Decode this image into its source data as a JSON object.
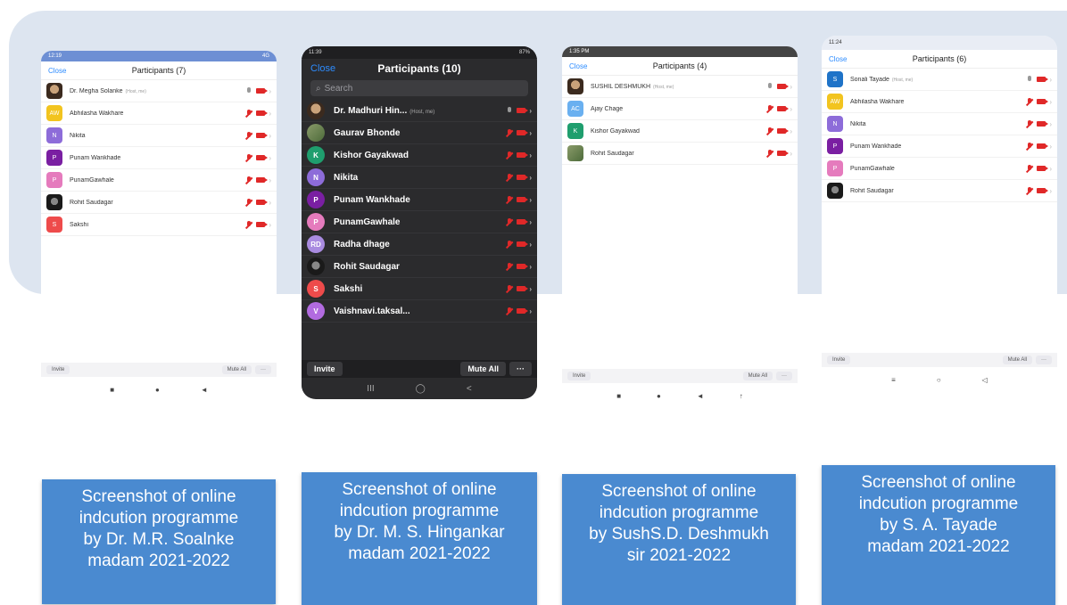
{
  "phones": [
    {
      "status_time": "12:19",
      "status_right": "4G",
      "close": "Close",
      "title": "Participants (7)",
      "participants": [
        {
          "name": "Dr. Megha Solanke",
          "tag": "(Host, me)",
          "avatar": "",
          "color": "#c9a27a"
        },
        {
          "name": "Abhilasha Wakhare",
          "tag": "",
          "avatar": "AW",
          "color": "#f2c41f"
        },
        {
          "name": "Nikita",
          "tag": "",
          "avatar": "N",
          "color": "#8d6cd9"
        },
        {
          "name": "Punam Wankhade",
          "tag": "",
          "avatar": "P",
          "color": "#7a1fa2"
        },
        {
          "name": "PunamGawhale",
          "tag": "",
          "avatar": "P",
          "color": "#e57bbd"
        },
        {
          "name": "Rohit Saudagar",
          "tag": "",
          "avatar": "",
          "color": "#222222"
        },
        {
          "name": "Sakshi",
          "tag": "",
          "avatar": "S",
          "color": "#ee4b4b"
        }
      ],
      "invite": "Invite",
      "mute_all": "Mute All",
      "more": "···",
      "nav": [
        "■",
        "●",
        "◄"
      ]
    },
    {
      "status_time": "11:39",
      "status_right": "87%",
      "close": "Close",
      "title": "Participants (10)",
      "search_placeholder": "Search",
      "participants": [
        {
          "name": "Dr. Madhuri Hin...",
          "tag": "(Host, me)",
          "avatar": "",
          "color": "#c9a27a"
        },
        {
          "name": "Gaurav Bhonde",
          "tag": "",
          "avatar": "",
          "color": "#6b8a4a"
        },
        {
          "name": "Kishor Gayakwad",
          "tag": "",
          "avatar": "K",
          "color": "#1f9e6e"
        },
        {
          "name": "Nikita",
          "tag": "",
          "avatar": "N",
          "color": "#8d6cd9"
        },
        {
          "name": "Punam Wankhade",
          "tag": "",
          "avatar": "P",
          "color": "#7a1fa2"
        },
        {
          "name": "PunamGawhale",
          "tag": "",
          "avatar": "P",
          "color": "#e57bbd"
        },
        {
          "name": "Radha dhage",
          "tag": "",
          "avatar": "RD",
          "color": "#a98be0"
        },
        {
          "name": "Rohit Saudagar",
          "tag": "",
          "avatar": "",
          "color": "#222222"
        },
        {
          "name": "Sakshi",
          "tag": "",
          "avatar": "S",
          "color": "#ee4b4b"
        },
        {
          "name": "Vaishnavi.taksal...",
          "tag": "",
          "avatar": "V",
          "color": "#b26be0"
        }
      ],
      "invite": "Invite",
      "mute_all": "Mute All",
      "more": "···",
      "nav": [
        "III",
        "◯",
        "<"
      ]
    },
    {
      "status_time": "1:35 PM",
      "status_right": "",
      "close": "Close",
      "title": "Participants (4)",
      "participants": [
        {
          "name": "SUSHIL DESHMUKH",
          "tag": "(Host, me)",
          "avatar": "",
          "color": "#8a4a2a"
        },
        {
          "name": "Ajay Chage",
          "tag": "",
          "avatar": "AC",
          "color": "#6ab0f0"
        },
        {
          "name": "Kishor Gayakwad",
          "tag": "",
          "avatar": "K",
          "color": "#1f9e6e"
        },
        {
          "name": "Rohit Saudagar",
          "tag": "",
          "avatar": "",
          "color": "#7a6a5a"
        }
      ],
      "invite": "Invite",
      "mute_all": "Mute All",
      "more": "···",
      "nav": [
        "■",
        "●",
        "◄",
        "↑"
      ]
    },
    {
      "status_time": "11:24",
      "status_right": "",
      "close": "Close",
      "title": "Participants (6)",
      "participants": [
        {
          "name": "Sonali Tayade",
          "tag": "(Host, me)",
          "avatar": "S",
          "color": "#1e73c8"
        },
        {
          "name": "Abhilasha Wakhare",
          "tag": "",
          "avatar": "AW",
          "color": "#f2c41f"
        },
        {
          "name": "Nikita",
          "tag": "",
          "avatar": "N",
          "color": "#8d6cd9"
        },
        {
          "name": "Punam Wankhade",
          "tag": "",
          "avatar": "P",
          "color": "#7a1fa2"
        },
        {
          "name": "PunamGawhale",
          "tag": "",
          "avatar": "P",
          "color": "#e57bbd"
        },
        {
          "name": "Rohit Saudagar",
          "tag": "",
          "avatar": "",
          "color": "#222222"
        }
      ],
      "invite": "Invite",
      "mute_all": "Mute All",
      "more": "···",
      "nav": [
        "≡",
        "○",
        "◁"
      ]
    }
  ],
  "captions": [
    [
      "Screenshot of online",
      "indcution programme",
      "by Dr. M.R. Soalnke",
      "madam 2021-2022"
    ],
    [
      "Screenshot of online",
      "indcution programme",
      "by Dr. M. S. Hingankar",
      "madam 2021-2022"
    ],
    [
      "Screenshot of online",
      "indcution programme",
      "by SushS.D. Deshmukh",
      "sir  2021-2022"
    ],
    [
      "Screenshot of online",
      "indcution programme",
      "by S. A. Tayade",
      "madam 2021-2022"
    ]
  ]
}
